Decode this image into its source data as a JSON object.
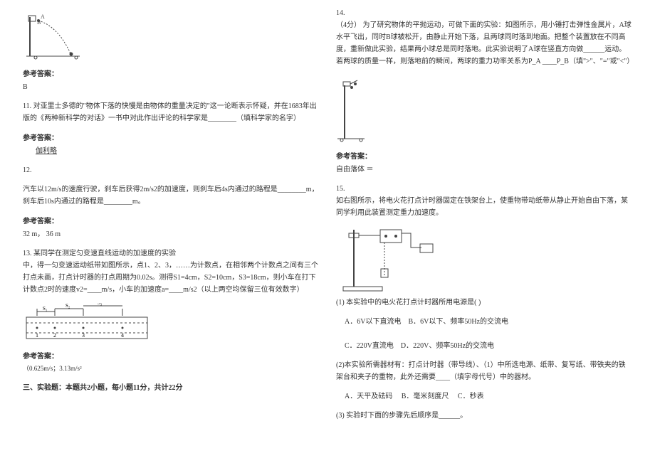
{
  "left": {
    "q10": {
      "answer_label": "参考答案：",
      "answer": "B"
    },
    "q11": {
      "num": "11.",
      "text": "对亚里士多德的\"物体下落的快慢是由物体的重量决定的\"这一论断表示怀疑，并在1683年出版的《两种新科学的对话》一书中对此作出评论的科学家是________（填科学家的名字）",
      "answer_label": "参考答案：",
      "answer": "伽利略"
    },
    "q12": {
      "num": "12.",
      "text": "汽车以12m/s的速度行驶，刹车后获得2m/s2的加速度，则刹车后4s内通过的路程是________m，刹车后10s内通过的路程是________m。",
      "answer_label": "参考答案：",
      "answer": "32  m，  36  m"
    },
    "q13": {
      "num": "13.",
      "title": "某同学在测定匀变速直线运动的加速度的实验",
      "text": "中，得一匀变速运动纸带如图所示，点1、2、3，……为计数点，在相邻两个计数点之间有三个打点未画，打点计时器的打点周期为0.02s。测得S1=4cm，S2=10cm，S3=18cm，则小车在打下计数点2时的速度v2=____m/s，小车的加速度a=____m/s2（以上两空均保留三位有效数字）",
      "answer_label": "参考答案：",
      "answer": "（0.625m/s；3.13m/s²"
    },
    "section": "三、实验题：本题共2小题，每小题11分，共计22分"
  },
  "right": {
    "q14": {
      "num": "14.",
      "score": "（4分）",
      "text": "为了研究物体的平抛运动，可做下面的实验：如图所示，用小锤打击弹性金属片，A球水平飞出，同时B球被松开，由静止开始下落，且两球同时落到地面。把整个装置放在不同高度，重新做此实验，结果两小球总是同时落地。此实验说明了A球在竖直方向做______运动。若两球的质量一样，则落地前的瞬间，两球的重力功率关系为P_A ____P_B（填\">\"、\"=\"或\"<\"）",
      "answer_label": "参考答案：",
      "answer": "自由落体 ＝"
    },
    "q15": {
      "num": "15.",
      "intro": "如右图所示，将电火花打点计时器固定在铁架台上，使重物带动纸带从静止开始自由下落，某同学利用此装置测定重力加速度。",
      "sub1": "(1) 本实验中的电火花打点计时器所用电源是(    )",
      "optA": "A．6V以下直流电",
      "optB": "B．6V以下、频率50Hz的交流电",
      "optC": "C．220V直流电",
      "optD": "D．220V、频率50Hz的交流电",
      "sub2": "(2)本实验所需器材有：打点计时器（带导线）、（1）中所选电源、纸带、复写纸、带铁夹的铁架台和夹子的重物，此外还需要____（填字母代号）中的器材。",
      "opt2A": "A．天平及砝码",
      "opt2B": "B．毫米刻度尺",
      "opt2C": "C．秒表",
      "sub3": "(3) 实验时下面的步骤先后顺序是______。"
    }
  }
}
